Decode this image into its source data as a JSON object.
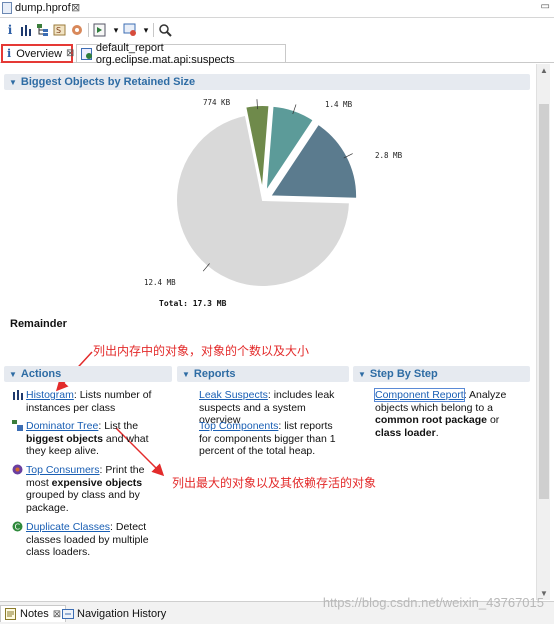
{
  "editor": {
    "title": "dump.hprof",
    "close_glyph": "⊠",
    "minmax_glyph": "▭"
  },
  "toolbar": {
    "icons": [
      "info-icon",
      "histogram-icon",
      "dominator-tree-icon",
      "sql-query-icon",
      "heap-dump-overview-icon",
      "run-report-icon",
      "query-browser-icon",
      "search-icon"
    ],
    "info_glyph": "i",
    "histogram_glyph": "▐",
    "dropdown_glyph": "▾",
    "search_glyph": "🔍"
  },
  "tabs": [
    {
      "label": "Overview",
      "close": "⊠"
    },
    {
      "label": "default_report  org.eclipse.mat.api:suspects"
    }
  ],
  "biggest_objects": {
    "header": "Biggest Objects by Retained Size",
    "slices": [
      {
        "label": "774 KB",
        "value": 0.774,
        "color": "#6f8a4b"
      },
      {
        "label": "1.4 MB",
        "value": 1.4,
        "color": "#5c9b99"
      },
      {
        "label": "2.8 MB",
        "value": 2.8,
        "color": "#5b7b8e"
      },
      {
        "label": "12.4 MB",
        "value": 12.4,
        "color": "#d9d9d9"
      }
    ],
    "total": "Total: 17.3 MB",
    "remainder": "Remainder"
  },
  "annotations": {
    "top": "列出内存中的对象，对象的个数以及大小",
    "middle": "列出最大的对象以及其依赖存活的对象"
  },
  "sections": {
    "actions": "Actions",
    "reports": "Reports",
    "step": "Step By Step"
  },
  "actions": [
    {
      "link": "Histogram",
      "pre": ": Lists number of instances per class"
    },
    {
      "link": "Dominator Tree",
      "pre": ": List the ",
      "bold": "biggest objects",
      "post": " and what they keep alive."
    },
    {
      "link": "Top Consumers",
      "pre": ": Print the most ",
      "bold": "expensive objects",
      "post": " grouped by class and by package."
    },
    {
      "link": "Duplicate Classes",
      "pre": ": Detect classes loaded by multiple class loaders."
    }
  ],
  "reports": [
    {
      "link": "Leak Suspects",
      "pre": ": includes leak suspects and a system overview"
    },
    {
      "link": "Top Components",
      "pre": ": list reports for components bigger than 1 percent of the total heap."
    }
  ],
  "steps": [
    {
      "link": "Component Report",
      "pre": ": Analyze objects which belong to a ",
      "bold": "common root package",
      "mid": " or ",
      "bold2": "class loader",
      "post": "."
    }
  ],
  "bottom_tabs": [
    {
      "label": "Notes",
      "close": "⊠"
    },
    {
      "label": "Navigation History"
    }
  ],
  "watermark": "https://blog.csdn.net/weixin_43767015"
}
